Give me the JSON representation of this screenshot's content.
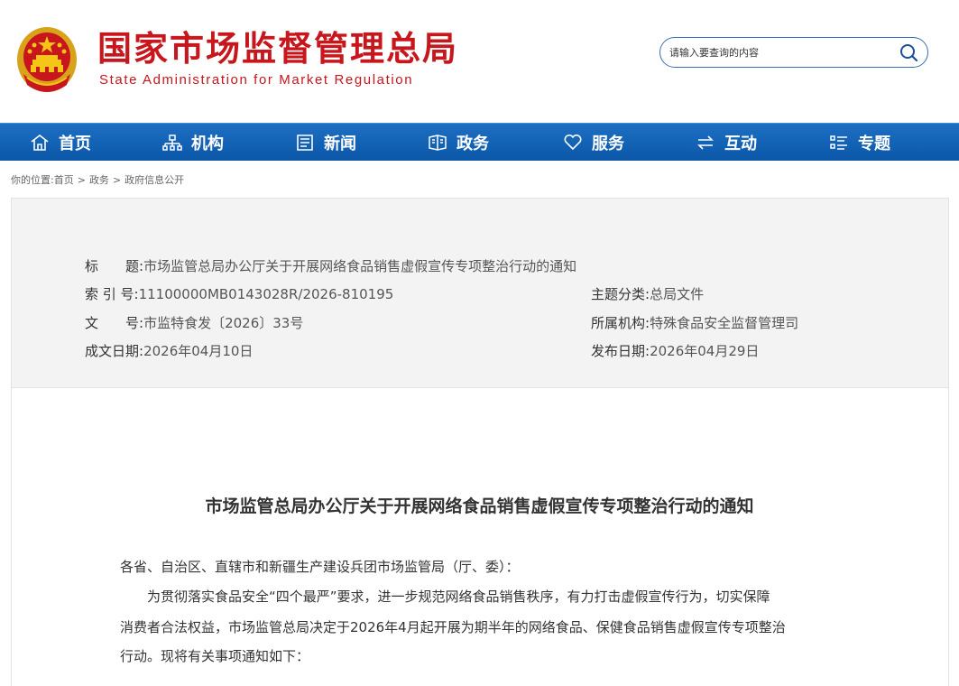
{
  "header": {
    "title_cn": "国家市场监督管理总局",
    "title_en": "State Administration for Market Regulation",
    "search_placeholder": "请输入要查询的内容"
  },
  "nav": [
    {
      "label": "首页",
      "icon": "home-icon"
    },
    {
      "label": "机构",
      "icon": "org-icon"
    },
    {
      "label": "新闻",
      "icon": "news-icon"
    },
    {
      "label": "政务",
      "icon": "gov-icon"
    },
    {
      "label": "服务",
      "icon": "heart-icon"
    },
    {
      "label": "互动",
      "icon": "swap-icon"
    },
    {
      "label": "专题",
      "icon": "list-icon"
    }
  ],
  "breadcrumb": {
    "prefix": "你的位置:",
    "items": [
      "首页",
      "政务",
      "政府信息公开"
    ],
    "separator": ">"
  },
  "meta": {
    "title_label": "标　　题:",
    "title_value": "市场监管总局办公厅关于开展网络食品销售虚假宣传专项整治行动的通知",
    "index_label": "索 引 号:",
    "index_value": "11100000MB0143028R/2026-810195",
    "category_label": "主题分类:",
    "category_value": "总局文件",
    "docno_label": "文　　号:",
    "docno_value": "市监特食发〔2026〕33号",
    "org_label": "所属机构:",
    "org_value": "特殊食品安全监督管理司",
    "created_label": "成文日期:",
    "created_value": "2026年04月10日",
    "published_label": "发布日期:",
    "published_value": "2026年04月29日"
  },
  "document": {
    "title": "市场监管总局办公厅关于开展网络食品销售虚假宣传专项整治行动的通知",
    "salutation": "各省、自治区、直辖市和新疆生产建设兵团市场监管局（厅、委）：",
    "para1_line1": "为贯彻落实食品安全“四个最严”要求，进一步规范网络食品销售秩序，有力打击虚假宣传行为，切实保障",
    "para1_line2": "消费者合法权益，市场监管总局决定于2026年4月起开展为期半年的网络食品、保健食品销售虚假宣传专项整治",
    "para1_line3": "行动。现将有关事项通知如下："
  },
  "colors": {
    "brand_red": "#c8161d",
    "nav_blue": "#0b57a8",
    "search_border": "#3b6db5"
  }
}
